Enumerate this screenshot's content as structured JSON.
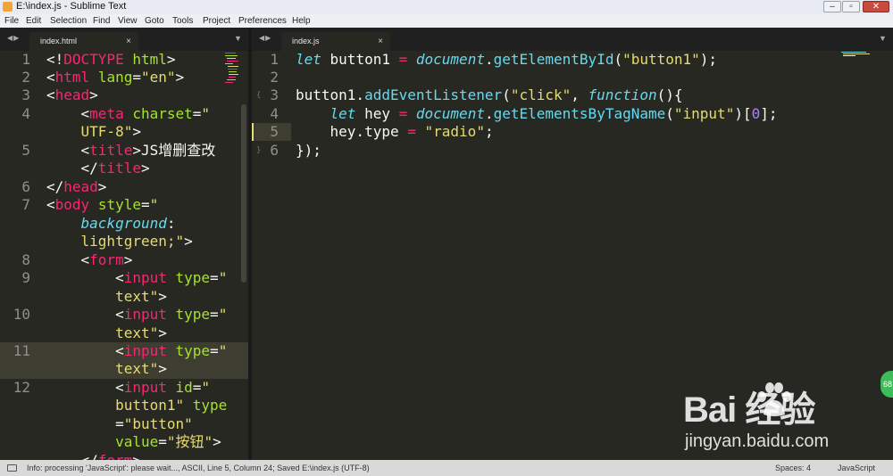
{
  "window": {
    "title": "E:\\index.js - Sublime Text"
  },
  "menu": [
    "File",
    "Edit",
    "Selection",
    "Find",
    "View",
    "Goto",
    "Tools",
    "Project",
    "Preferences",
    "Help"
  ],
  "tabs": {
    "left": {
      "label": "index.html",
      "close": "×"
    },
    "right": {
      "label": "index.js",
      "close": "×"
    }
  },
  "left_gutter": [
    "1",
    "2",
    "3",
    "4",
    "",
    "5",
    "",
    "6",
    "7",
    "",
    "",
    "8",
    "9",
    "",
    "10",
    "",
    "11",
    "",
    "12",
    "",
    "",
    ""
  ],
  "right_gutter": [
    "1",
    "2",
    "3",
    "4",
    "5",
    "6"
  ],
  "status": {
    "info": "Info: processing 'JavaScript': please wait..., ASCII, Line 5, Column 24; Saved E:\\index.js (UTF-8)",
    "spaces": "Spaces: 4",
    "syntax": "JavaScript"
  },
  "watermark": {
    "brand": "Bai  经验",
    "url": "jingyan.baidu.com"
  },
  "side_badge": "68",
  "colors": {
    "background": "#272822",
    "tag": "#f92672",
    "attr": "#a6e22e",
    "string": "#e6db74",
    "keyword": "#66d9ef",
    "number": "#ae81ff",
    "line_number": "#8f908a"
  },
  "icons": {
    "window_min": "minimize-icon",
    "window_max": "maximize-icon",
    "window_close": "close-icon",
    "dropdown": "chevron-down-icon",
    "nav": "arrow-left-right-icon"
  }
}
